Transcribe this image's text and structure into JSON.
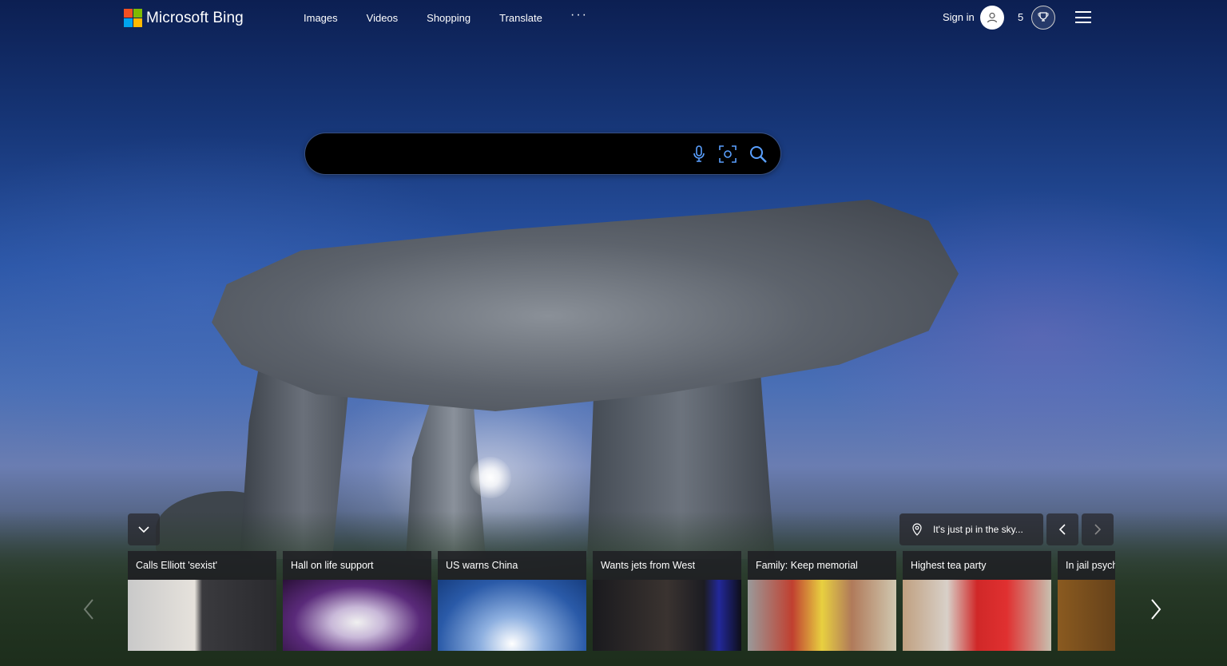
{
  "header": {
    "logo_text": "Microsoft Bing",
    "nav": [
      "Images",
      "Videos",
      "Shopping",
      "Translate"
    ],
    "more": "···",
    "sign_in": "Sign in",
    "rewards_count": "5"
  },
  "search": {
    "placeholder": "",
    "value": ""
  },
  "image_info": {
    "text": "It's just pi in the sky..."
  },
  "news": [
    {
      "title": "Calls Elliott 'sexist'"
    },
    {
      "title": "Hall on life support"
    },
    {
      "title": "US warns China"
    },
    {
      "title": "Wants jets from West"
    },
    {
      "title": "Family: Keep memorial"
    },
    {
      "title": "Highest tea party"
    },
    {
      "title": "In jail psych"
    }
  ],
  "colors": {
    "ms_red": "#f25022",
    "ms_green": "#7fba00",
    "ms_blue": "#00a4ef",
    "ms_yellow": "#ffb900"
  }
}
